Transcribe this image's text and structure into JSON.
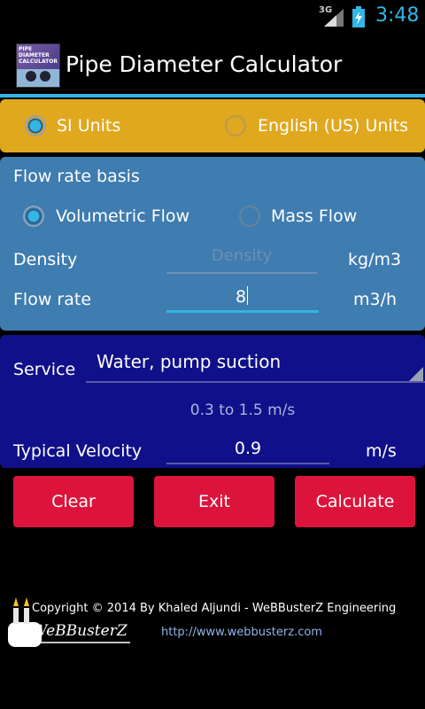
{
  "status_bar": {
    "network": "3G",
    "time": "3:48"
  },
  "app": {
    "title": "Pipe Diameter Calculator",
    "icon_text": "PIPE DIAMETER CALCULATOR"
  },
  "units": {
    "si_label": "SI Units",
    "english_label": "English (US) Units",
    "selected": "si"
  },
  "flow_basis": {
    "heading": "Flow rate basis",
    "volumetric_label": "Volumetric Flow",
    "mass_label": "Mass Flow",
    "selected": "volumetric"
  },
  "density": {
    "label": "Density",
    "value": "",
    "placeholder": "Density",
    "unit": "kg/m3"
  },
  "flow_rate": {
    "label": "Flow rate",
    "value": "8",
    "unit": "m3/h"
  },
  "service": {
    "label": "Service",
    "selected": "Water, pump suction",
    "range_text": "0.3 to 1.5 m/s"
  },
  "velocity": {
    "label": "Typical Velocity",
    "value": "0.9",
    "unit": "m/s"
  },
  "buttons": {
    "clear": "Clear",
    "exit": "Exit",
    "calculate": "Calculate"
  },
  "footer": {
    "copyright": "Copyright © 2014 By Khaled Aljundi - WeBBusterZ Engineering",
    "link": "http://www.webbusterz.com",
    "logo_text": "WeBBusterZ"
  },
  "colors": {
    "accent": "#33b5e5",
    "units_panel": "#e0a81e",
    "flow_panel": "#3f7cb0",
    "service_panel": "#10108a",
    "button": "#dc143c"
  }
}
